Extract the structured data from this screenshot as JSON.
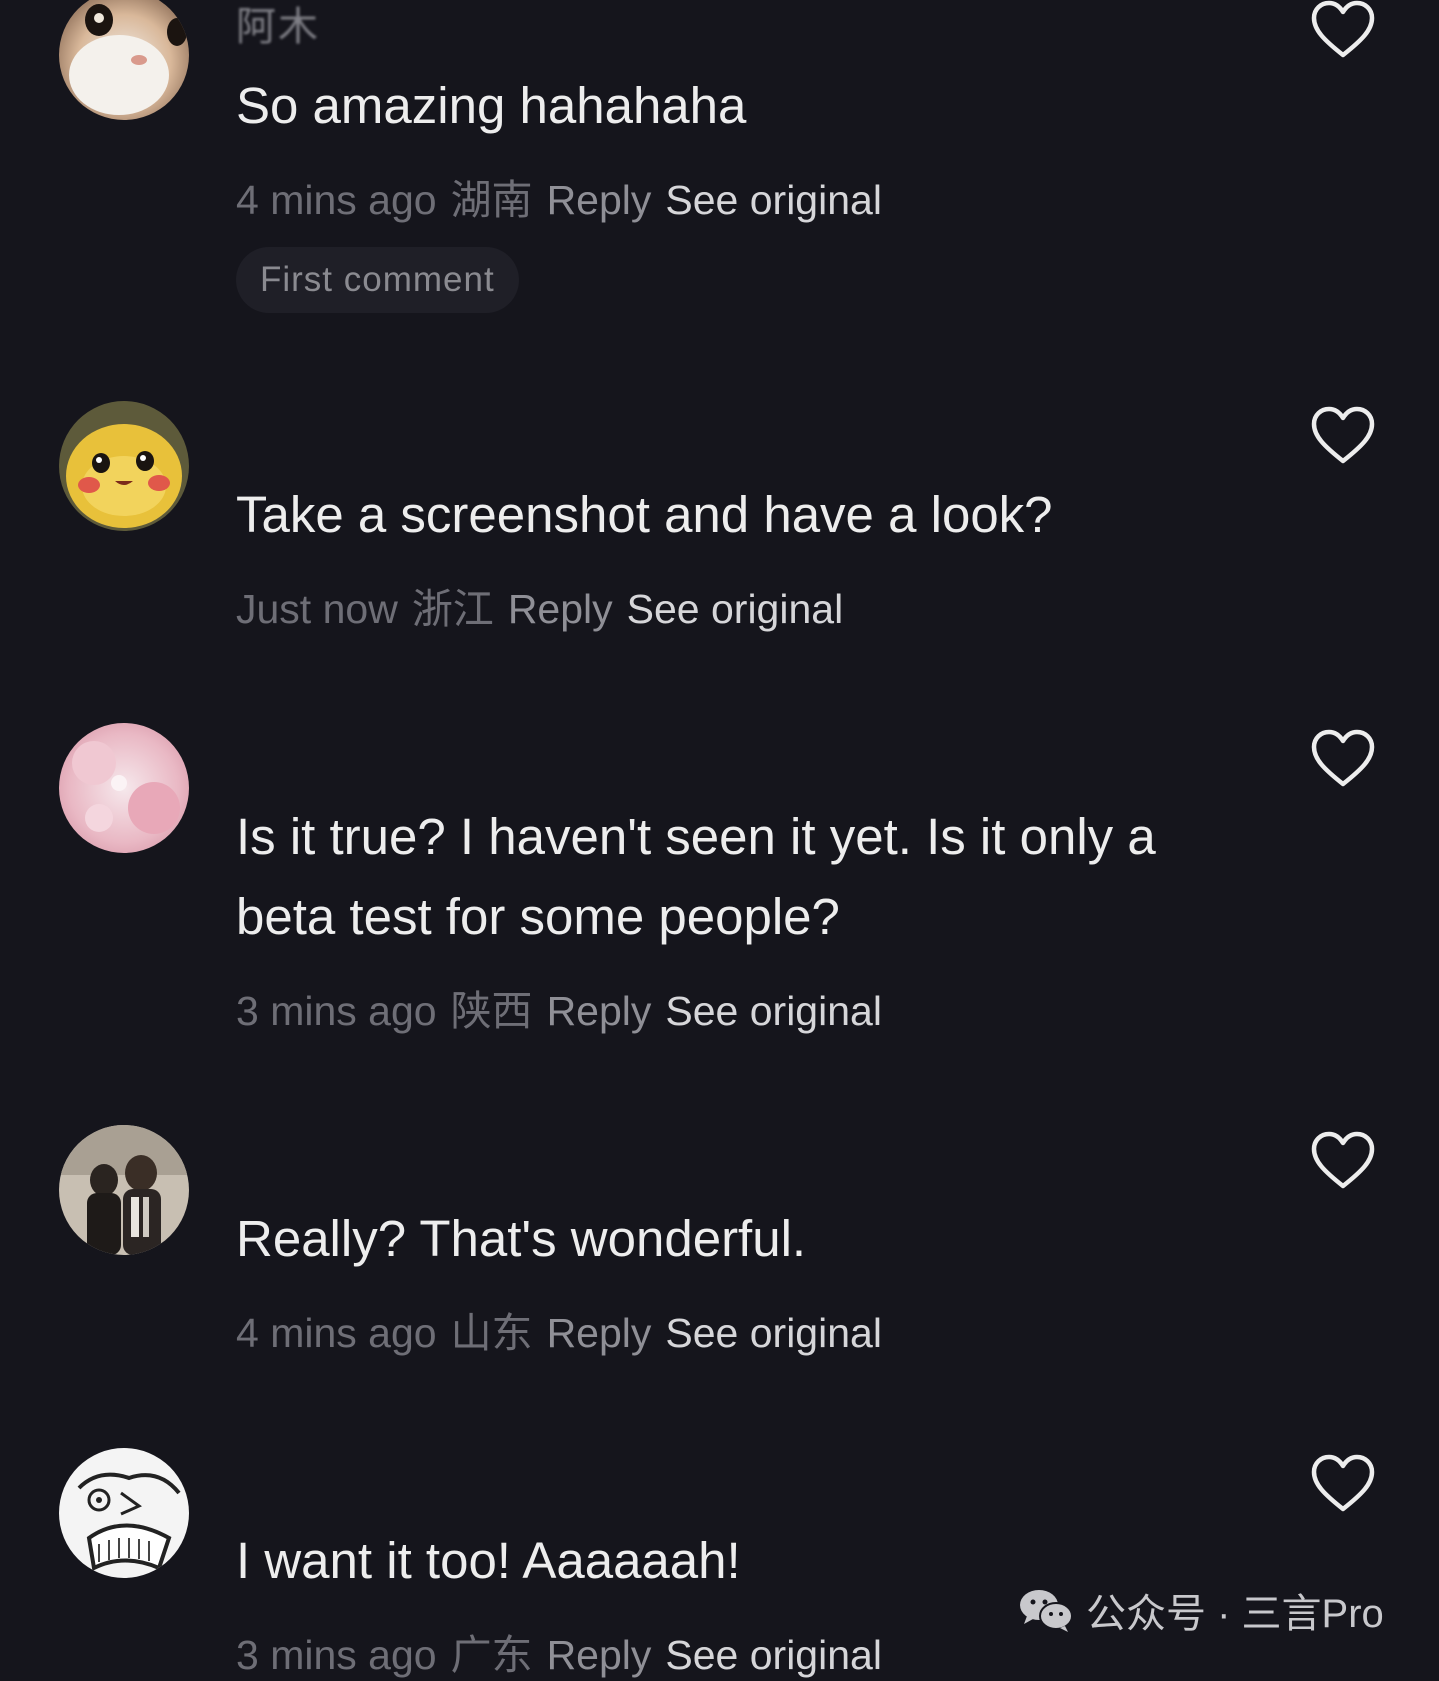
{
  "comments": [
    {
      "username": "阿木",
      "text": "So amazing hahahaha",
      "time": "4 mins ago",
      "location": "湖南",
      "reply_label": "Reply",
      "see_original_label": "See original",
      "badge": "First comment",
      "avatar_icon": "cat-avatar"
    },
    {
      "username": "",
      "text": "Take a screenshot and have a look?",
      "time": "Just now",
      "location": "浙江",
      "reply_label": "Reply",
      "see_original_label": "See original",
      "avatar_icon": "pikachu-avatar"
    },
    {
      "username": "",
      "text": "Is it true? I haven't seen it yet. Is it only a beta test for some people?",
      "time": "3 mins ago",
      "location": "陕西",
      "reply_label": "Reply",
      "see_original_label": "See original",
      "avatar_icon": "pink-flower-avatar"
    },
    {
      "username": "",
      "text": "Really? That's wonderful.",
      "time": "4 mins ago",
      "location": "山东",
      "reply_label": "Reply",
      "see_original_label": "See original",
      "avatar_icon": "person-photo-avatar"
    },
    {
      "username": "",
      "text": "I want it too! Aaaaaah!",
      "time": "3 mins ago",
      "location": "广东",
      "reply_label": "Reply",
      "see_original_label": "See original",
      "avatar_icon": "manga-face-avatar"
    }
  ],
  "like_icon": "heart-outline-icon",
  "watermark": {
    "icon": "wechat-icon",
    "text": "公众号 · 三言Pro"
  },
  "colors": {
    "background": "#15151c",
    "primary_text": "#ededed",
    "secondary_text": "#6e6e76",
    "see_original": "#d6d6d9",
    "badge_bg": "#1f1f27"
  }
}
